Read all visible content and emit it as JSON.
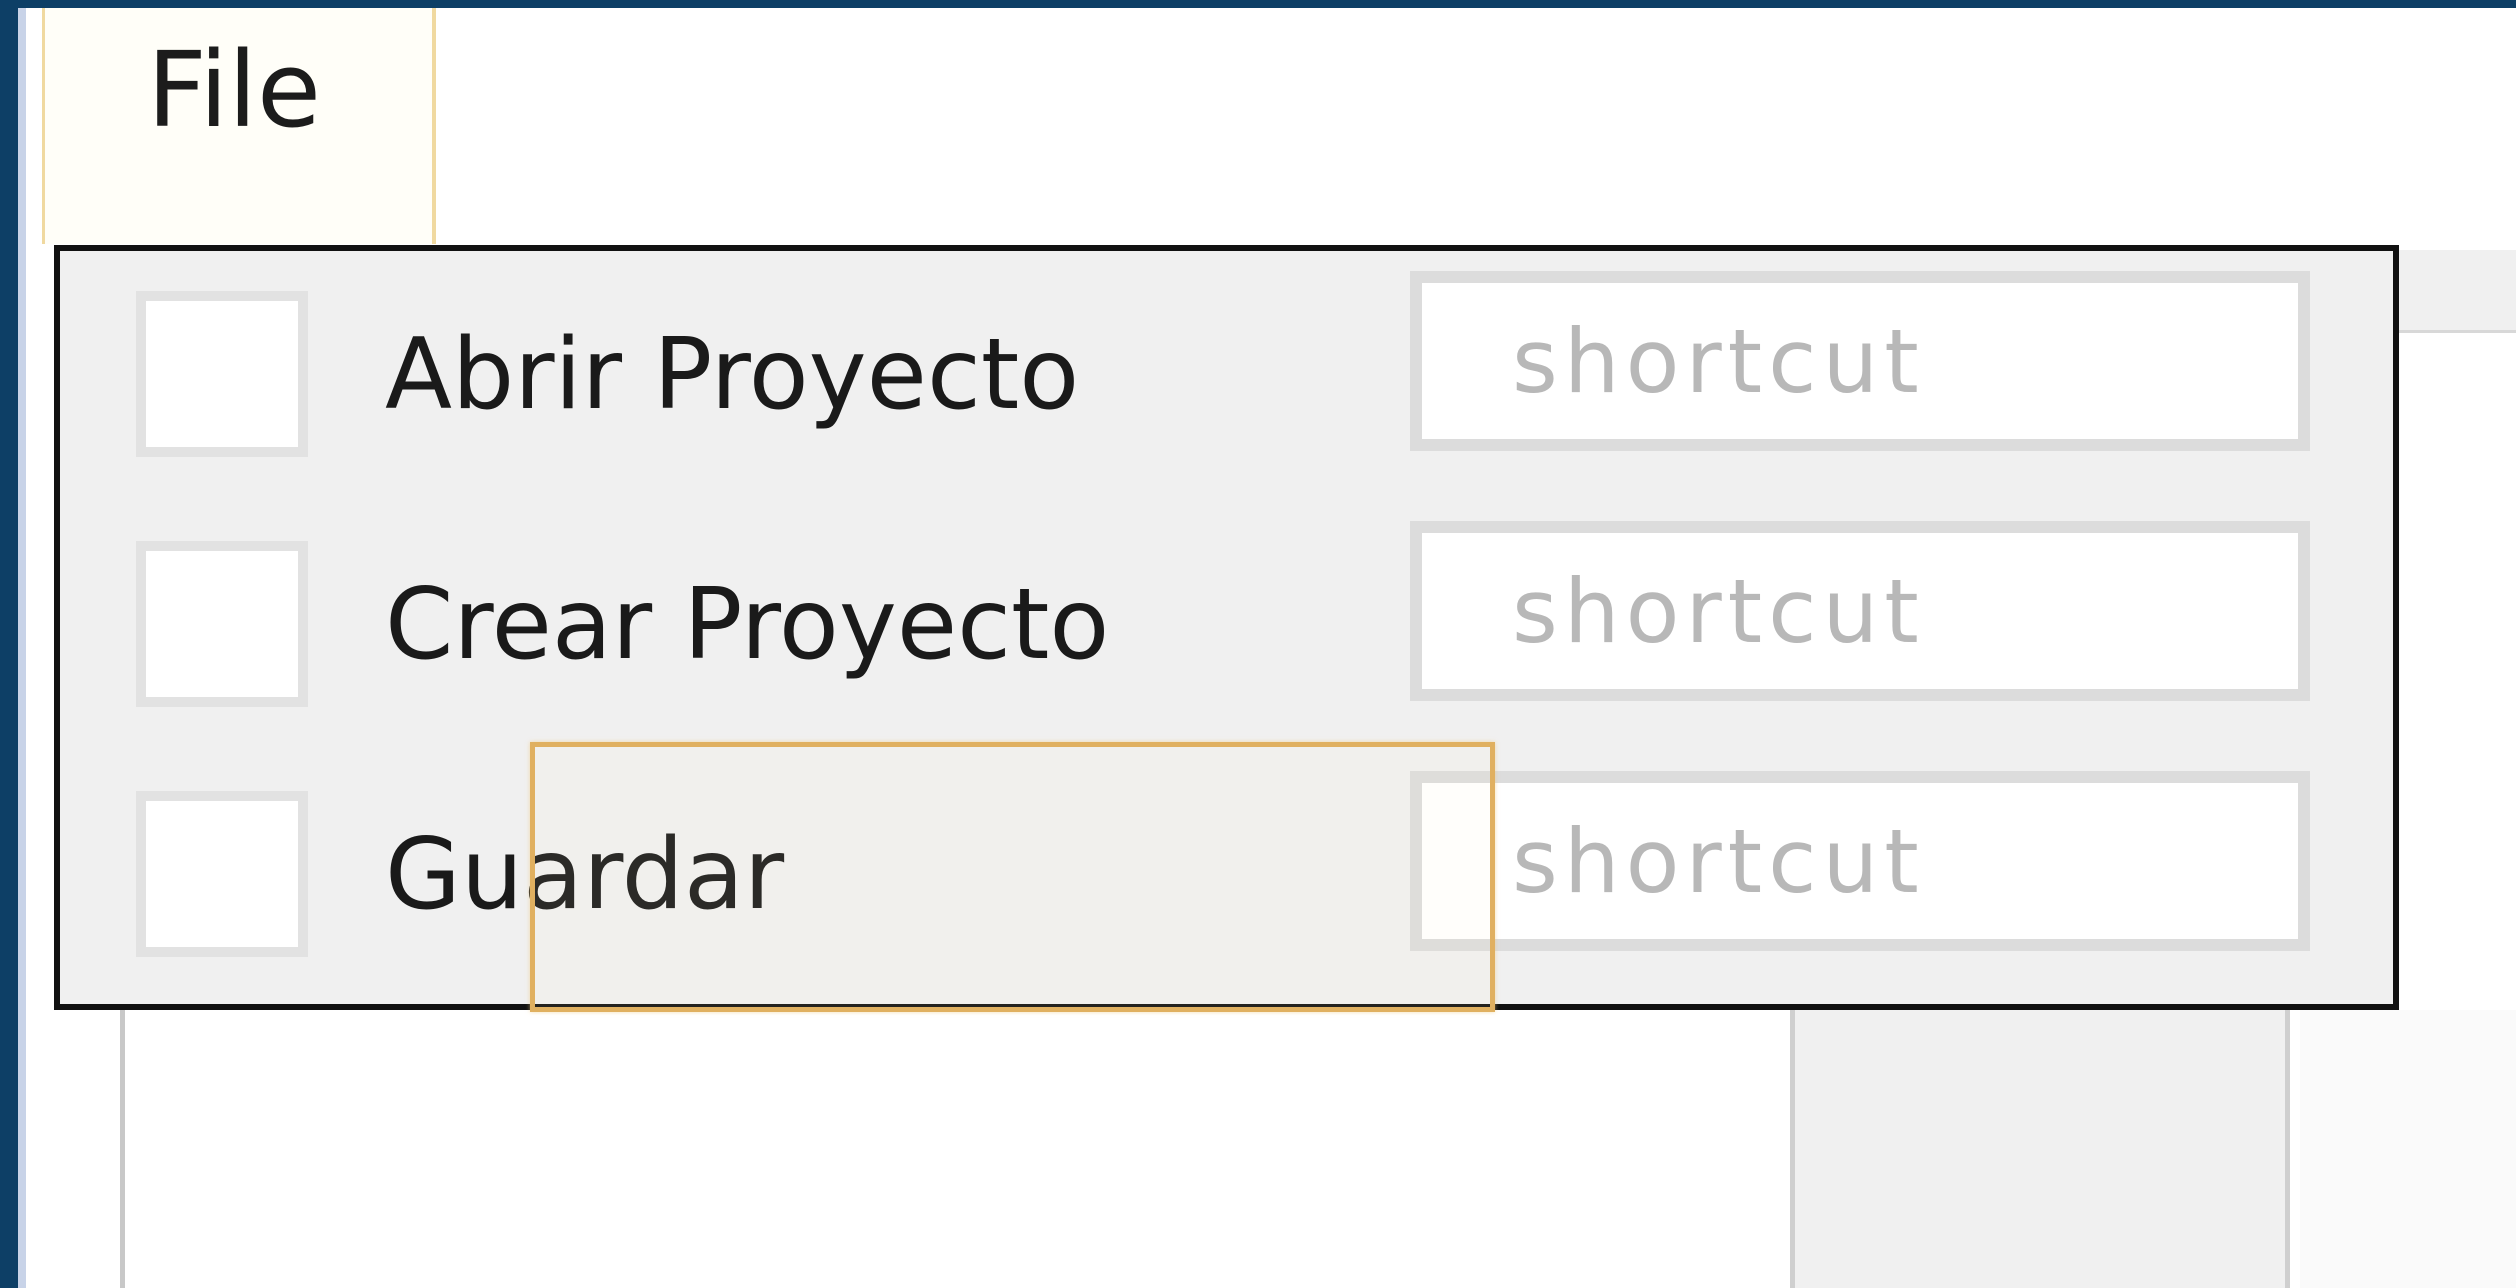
{
  "menubar": {
    "file_label": "File"
  },
  "file_menu": {
    "items": [
      {
        "label": "Abrir Proyecto",
        "shortcut_placeholder": "shortcut",
        "checked": false
      },
      {
        "label": "Crear Proyecto",
        "shortcut_placeholder": "shortcut",
        "checked": false
      },
      {
        "label": "Guardar",
        "shortcut_placeholder": "shortcut",
        "checked": false
      }
    ]
  },
  "colors": {
    "window_frame": "#0d3f66",
    "popup_background": "#f0f0f0",
    "popup_border": "#111111",
    "highlight_border": "#e0b060"
  }
}
